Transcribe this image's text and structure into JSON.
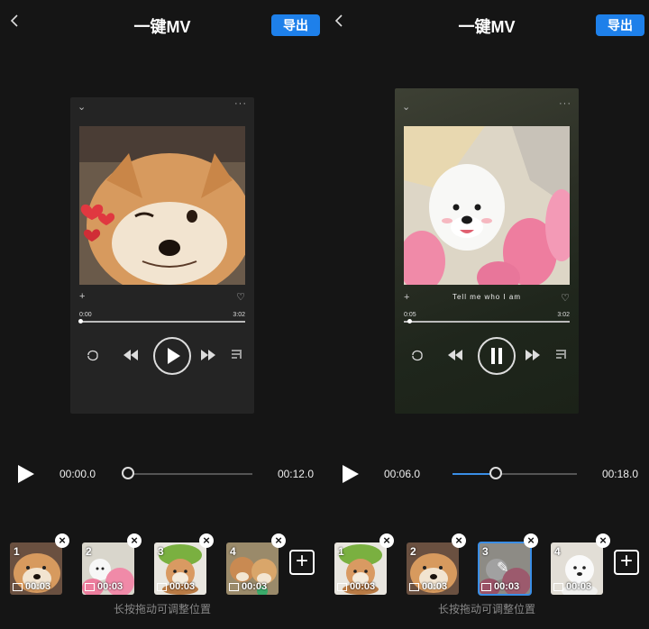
{
  "panels": [
    {
      "header": {
        "back_icon": "chevron-left-icon",
        "title": "一键MV",
        "export_label": "导出"
      },
      "preview": {
        "time_start": "0:00",
        "time_end": "3:02",
        "progress": 0.0,
        "lyric": "",
        "playing": false
      },
      "playback": {
        "current": "00:00.0",
        "total": "00:12.0",
        "progress": 0.0
      },
      "clips": [
        {
          "index": "1",
          "duration": "00:03",
          "subject": "shiba dog",
          "selected": false
        },
        {
          "index": "2",
          "duration": "00:03",
          "subject": "white dog with tulips",
          "selected": false
        },
        {
          "index": "3",
          "duration": "00:03",
          "subject": "dog with frog hat",
          "selected": false
        },
        {
          "index": "4",
          "duration": "00:03",
          "subject": "two dogs",
          "selected": false
        }
      ],
      "hint": "长按拖动可调整位置"
    },
    {
      "header": {
        "back_icon": "chevron-left-icon",
        "title": "一键MV",
        "export_label": "导出"
      },
      "preview": {
        "time_start": "0:05",
        "time_end": "3:02",
        "progress": 0.03,
        "lyric": "Tell me who I am",
        "playing": true
      },
      "playback": {
        "current": "00:06.0",
        "total": "00:18.0",
        "progress": 0.35
      },
      "clips": [
        {
          "index": "1",
          "duration": "00:03",
          "subject": "dog with frog hat",
          "selected": false
        },
        {
          "index": "2",
          "duration": "00:03",
          "subject": "shiba dog",
          "selected": false
        },
        {
          "index": "3",
          "duration": "00:03",
          "subject": "white dog with tulips",
          "selected": true
        },
        {
          "index": "4",
          "duration": "00:03",
          "subject": "white dog",
          "selected": false
        }
      ],
      "hint": "长按拖动可调整位置"
    }
  ],
  "colors": {
    "accent": "#1e80ea",
    "background": "#151515"
  }
}
